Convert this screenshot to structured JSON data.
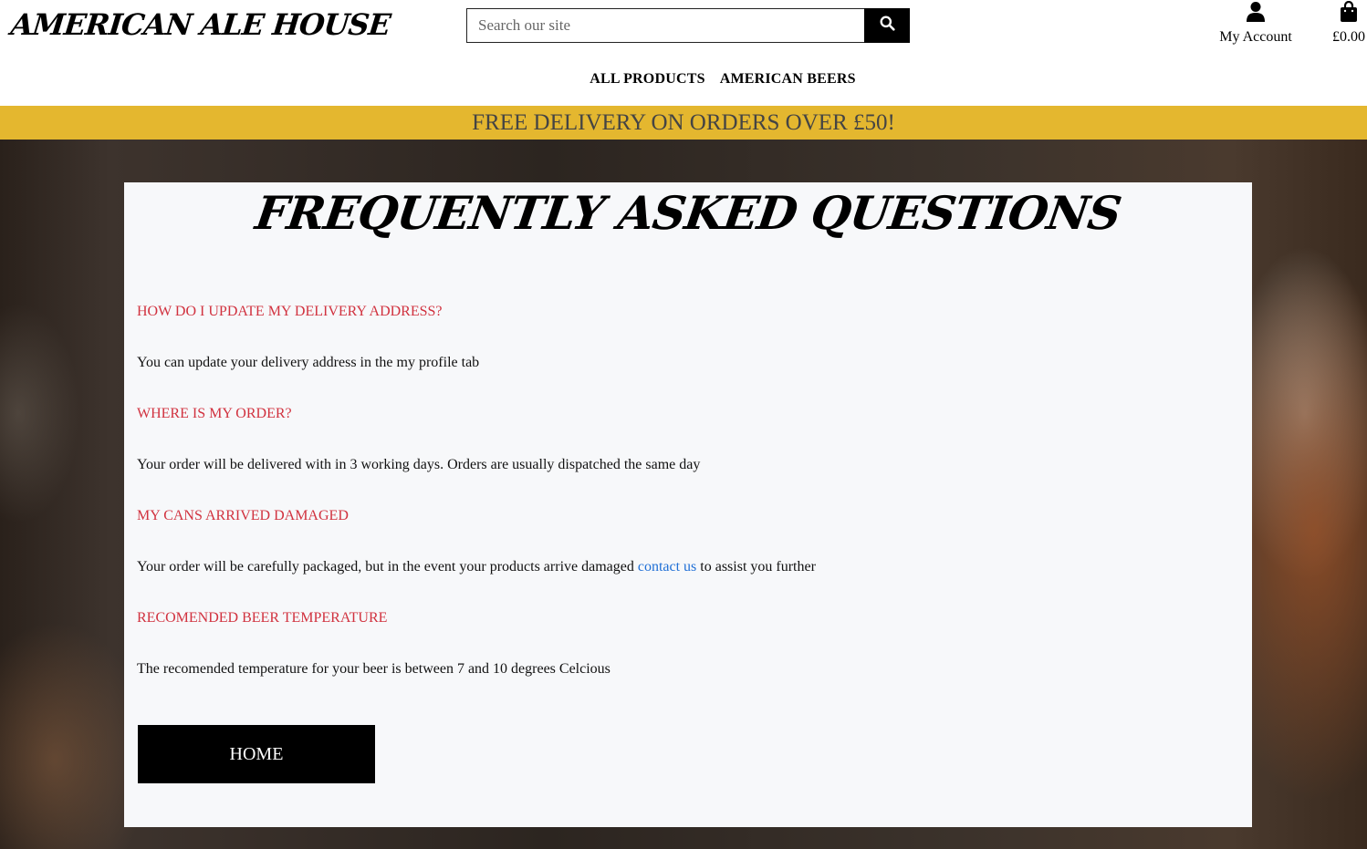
{
  "header": {
    "logo": "AMERICAN ALE HOUSE",
    "search_placeholder": "Search our site",
    "account_label": "My Account",
    "bag_total": "£0.00",
    "nav": [
      "ALL PRODUCTS",
      "AMERICAN BEERS"
    ]
  },
  "banner": {
    "text": "FREE DELIVERY ON ORDERS OVER £50!"
  },
  "faq": {
    "title": "FREQUENTLY ASKED QUESTIONS",
    "items": [
      {
        "question": "HOW DO I UPDATE MY DELIVERY ADDRESS?",
        "answer": "You can update your delivery address in the my profile tab"
      },
      {
        "question": "WHERE IS MY ORDER?",
        "answer": "Your order will be delivered with in 3 working days. Orders are usually dispatched the same day"
      },
      {
        "question": "MY CANS ARRIVED DAMAGED",
        "answer_before": "Your order will be carefully packaged, but in the event your products arrive damaged",
        "answer_link": "contact us",
        "answer_after": "to assist you further"
      },
      {
        "question": "RECOMENDED BEER TEMPERATURE",
        "answer": "The recomended temperature for your beer is between 7 and 10 degrees Celcious"
      }
    ],
    "home_button": "HOME"
  },
  "colors": {
    "banner": "#e4b72f",
    "question": "#d1323f",
    "link": "#1f6fd6",
    "card": "#f7f8fa"
  },
  "icons": {
    "search": "search-icon",
    "account": "user-icon",
    "bag": "shopping-bag-icon"
  }
}
